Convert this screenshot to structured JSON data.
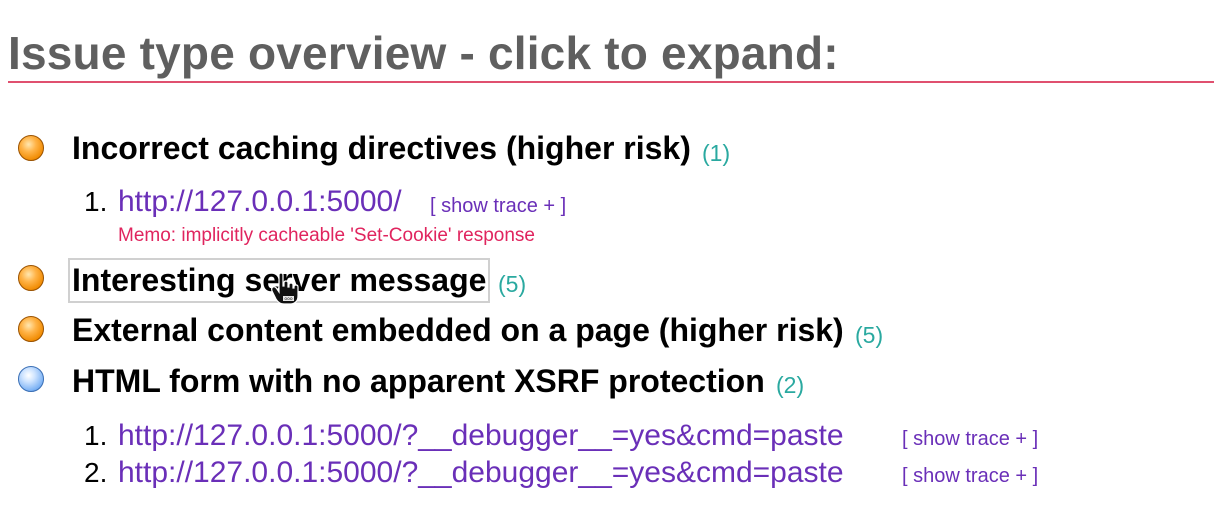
{
  "heading": "Issue type overview - click to expand:",
  "issues": [
    {
      "severity": "orange",
      "title": "Incorrect caching directives (higher risk)",
      "count": "(1)",
      "items": [
        {
          "num": "1.",
          "url": "http://127.0.0.1:5000/",
          "trace": "[ show trace + ]",
          "memo": "Memo: implicitly cacheable 'Set-Cookie' response"
        }
      ]
    },
    {
      "severity": "orange",
      "title": "Interesting server message",
      "count": "(5)"
    },
    {
      "severity": "orange",
      "title": "External content embedded on a page (higher risk)",
      "count": "(5)"
    },
    {
      "severity": "blue",
      "title": "HTML form with no apparent XSRF protection",
      "count": "(2)",
      "items": [
        {
          "num": "1.",
          "url": "http://127.0.0.1:5000/?__debugger__=yes&cmd=paste",
          "trace": "[ show trace + ]"
        },
        {
          "num": "2.",
          "url": "http://127.0.0.1:5000/?__debugger__=yes&cmd=paste",
          "trace": "[ show trace + ]"
        }
      ]
    }
  ],
  "colors": {
    "heading": "#5f5f5f",
    "rule": "#e0506f",
    "link": "#6a2fb8",
    "count": "#2aa9a0",
    "memo": "#e0245e",
    "severity_medium": "#f08a00",
    "severity_info": "#7fb4f5"
  }
}
